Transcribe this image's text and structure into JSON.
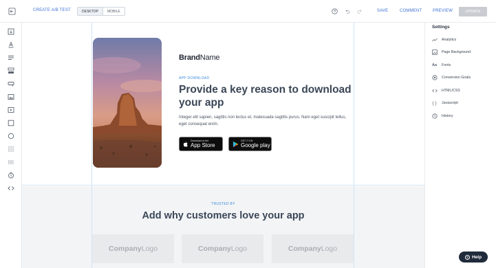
{
  "topbar": {
    "ab_test_label": "CREATE A/B TEST",
    "device_options": [
      "DESKTOP",
      "MOBILE"
    ],
    "device_selected": "DESKTOP",
    "save_label": "SAVE",
    "comment_label": "COMMENT",
    "preview_label": "PREVIEW",
    "update_label": "UPDATE"
  },
  "left_tools": [
    "exit-icon",
    "text-icon",
    "paragraph-icon",
    "form-icon",
    "button-icon",
    "image-icon",
    "video-icon",
    "section-icon",
    "circle-icon",
    "columns-icon",
    "divider-icon",
    "timer-icon",
    "code-icon"
  ],
  "canvas": {
    "brand_bold": "Brand",
    "brand_regular": "Name",
    "eyebrow": "APP DOWNLOAD",
    "headline": "Provide a key reason to download your app",
    "body": "Integer elit sapien, sagittis non lectus et, malesuada sagittis purus. Nam eget suscipit tellus, eget consequat enim.",
    "appstore_small": "Download on the",
    "appstore_big": "App Store",
    "googleplay_small": "GET IT ON",
    "googleplay_big": "Google play",
    "trusted_by": "TRUSTED BY",
    "why_heading": "Add why customers love your app",
    "logos": [
      {
        "bold": "Company",
        "regular": "Logo"
      },
      {
        "bold": "Company",
        "regular": "Logo"
      },
      {
        "bold": "Company",
        "regular": "Logo"
      }
    ]
  },
  "settings": {
    "title": "Settings",
    "items": [
      {
        "label": "Analytics",
        "icon": "analytics-icon"
      },
      {
        "label": "Page Background",
        "icon": "background-icon"
      },
      {
        "label": "Fonts",
        "icon": "fonts-icon"
      },
      {
        "label": "Conversion Goals",
        "icon": "target-icon"
      },
      {
        "label": "HTML/CSS",
        "icon": "code-icon"
      },
      {
        "label": "Javascript",
        "icon": "braces-icon"
      },
      {
        "label": "History",
        "icon": "history-icon"
      }
    ]
  },
  "help": {
    "label": "Help"
  },
  "colors": {
    "accent": "#3b6fd4",
    "eyebrow": "#3b8bd9",
    "update_bg": "#c9ccd1",
    "help_bg": "#1f2a3a"
  }
}
